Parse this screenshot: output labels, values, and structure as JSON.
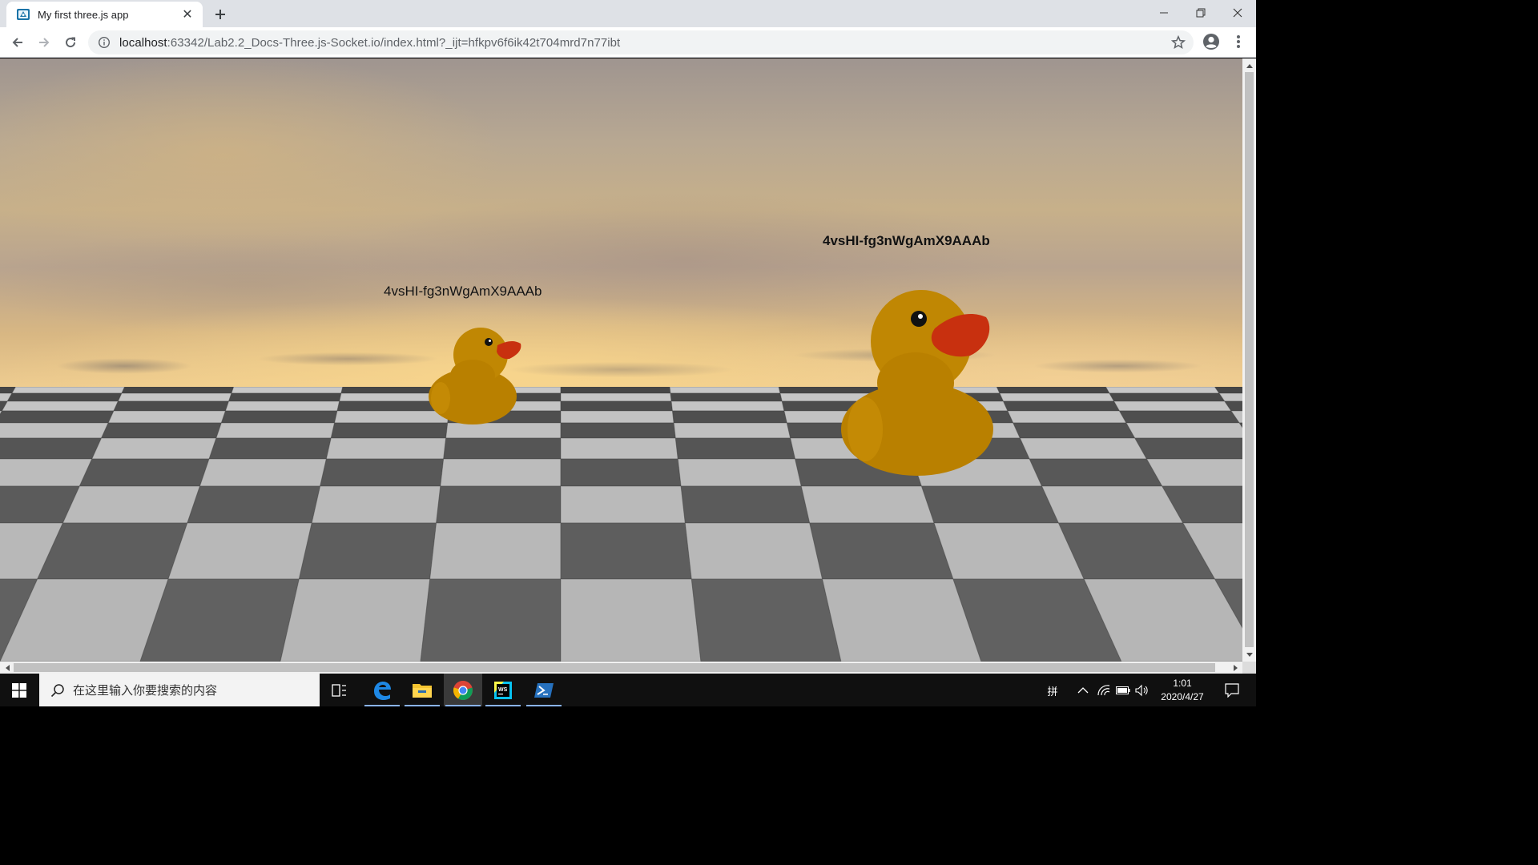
{
  "browser": {
    "tab_title": "My first three.js app",
    "tab_close_glyph": "✕",
    "new_tab_glyph": "+",
    "url_host": "localhost",
    "url_rest": ":63342/Lab2.2_Docs-Three.js-Socket.io/index.html?_ijt=hfkpv6f6ik42t704mrd7n77ibt",
    "icons": {
      "favicon": "threejs-favicon-icon",
      "back": "back-arrow-icon",
      "forward": "forward-arrow-icon",
      "reload": "reload-icon",
      "site_info": "info-icon",
      "bookmark": "star-icon",
      "profile": "account-circle-icon",
      "menu": "kebab-menu-icon",
      "minimize": "minimize-icon",
      "restore": "restore-icon",
      "close": "close-icon"
    }
  },
  "scene": {
    "player_label_near": "4vsHI-fg3nWgAmX9AAAb",
    "player_label_far": "4vsHI-fg3nWgAmX9AAAb",
    "duck_color": "#b98000",
    "beak_color": "#c8300f"
  },
  "taskbar": {
    "search_placeholder": "在这里输入你要搜索的内容",
    "apps": [
      "task-view",
      "edge",
      "file-explorer",
      "chrome",
      "webstorm",
      "powershell"
    ],
    "ime_indicator": "拼",
    "time": "1:01",
    "date": "2020/4/27"
  }
}
